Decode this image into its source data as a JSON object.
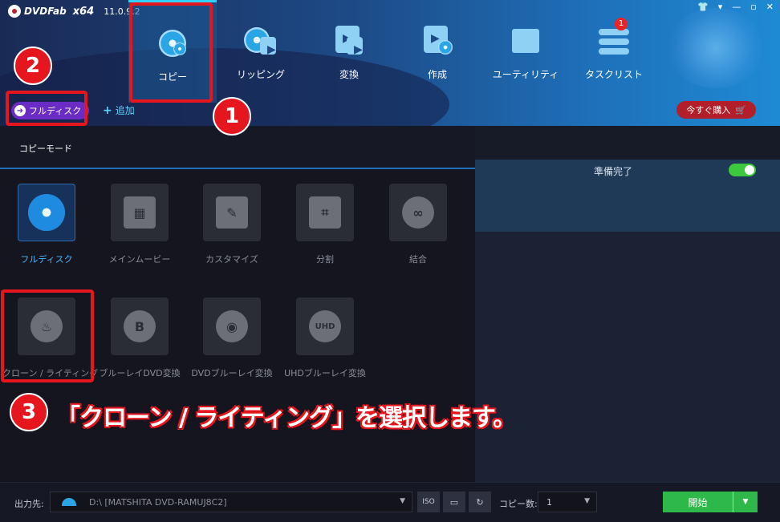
{
  "app": {
    "brand": "DVDFab",
    "arch": "x64",
    "version": "11.0.9.2"
  },
  "window_controls": [
    "shirt-icon",
    "minimize-icon",
    "restore-icon",
    "close-icon"
  ],
  "nav": [
    {
      "label": "コピー",
      "active": true
    },
    {
      "label": "リッピング"
    },
    {
      "label": "変換"
    },
    {
      "label": "作成"
    },
    {
      "label": "ユーティリティ"
    },
    {
      "label": "タスクリスト",
      "badge": "1"
    }
  ],
  "subbar": {
    "current": "フルディスク",
    "add": "追加",
    "buy": "今すぐ購入"
  },
  "copy_mode": {
    "title": "コピーモード"
  },
  "modes": [
    {
      "label": "フルディスク",
      "active": true
    },
    {
      "label": "メインムービー"
    },
    {
      "label": "カスタマイズ"
    },
    {
      "label": "分割"
    },
    {
      "label": "結合"
    },
    {
      "label": "クローン / ライティング"
    },
    {
      "label": "ブルーレイDVD変換"
    },
    {
      "label": "DVDブルーレイ変換"
    },
    {
      "label": "UHDブルーレイ変換"
    }
  ],
  "right": {
    "status": "準備完了",
    "toggle_on": true
  },
  "annotations": {
    "n1": "1",
    "n2": "2",
    "n3": "3",
    "callout": "「クローン / ライティング」を選択します。",
    "color": "#e5161d"
  },
  "bottom": {
    "output_label": "出力先:",
    "output_value": "D:\\ [MATSHITA DVD-RAMUJ8C2]",
    "iso_label": "ISO",
    "copies_label": "コピー数:",
    "copies_value": "1",
    "start_label": "開始"
  },
  "colors": {
    "accent": "#1e6fb8",
    "start": "#2fb84a",
    "buy": "#b21e2a"
  }
}
